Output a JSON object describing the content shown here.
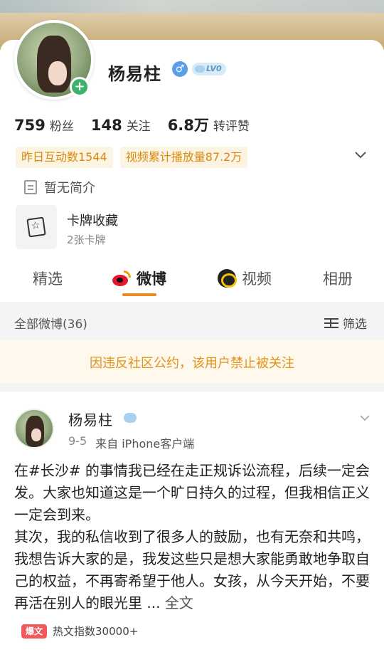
{
  "profile": {
    "username": "杨易柱",
    "level": "LV0",
    "stats": [
      {
        "value": "759",
        "label": "粉丝"
      },
      {
        "value": "148",
        "label": "关注"
      },
      {
        "value": "6.8万",
        "label": "转评赞"
      }
    ],
    "highlights": [
      "昨日互动数1544",
      "视频累计播放量87.2万"
    ],
    "intro": "暂无简介",
    "cards": {
      "title": "卡牌收藏",
      "count": "2张卡牌"
    }
  },
  "tabs": [
    {
      "label": "精选",
      "active": false
    },
    {
      "label": "微博",
      "active": true
    },
    {
      "label": "视频",
      "active": false
    },
    {
      "label": "相册",
      "active": false
    }
  ],
  "filter": {
    "all_label": "全部微博(36)",
    "filter_label": "筛选"
  },
  "notice": "因违反社区公约，该用户禁止被关注",
  "post": {
    "author": "杨易柱",
    "date": "9-5",
    "source": "来自 iPhone客户端",
    "paragraph1_prefix": "在",
    "topic": "#长沙#",
    "paragraph1_rest": " 的事情我已经在走正规诉讼流程，后续一定会发。大家也知道这是一个旷日持久的过程，但我相信正义一定会到来。",
    "paragraph2": "其次，我的私信收到了很多人的鼓励，也有无奈和共鸣，我想告诉大家的是，我发这些只是想大家能勇敢地争取自己的权益，不再寄希望于他人。女孩，从今天开始，不要再活在别人的眼光里 ... ",
    "full_text_label": "全文",
    "hot_badge": "爆文",
    "hot_index": "热文指数30000+"
  },
  "colors": {
    "accent": "#f08a24",
    "highlight_text": "#d98a10",
    "notice_text": "#e0921a",
    "weibo_red": "#e6162d"
  }
}
